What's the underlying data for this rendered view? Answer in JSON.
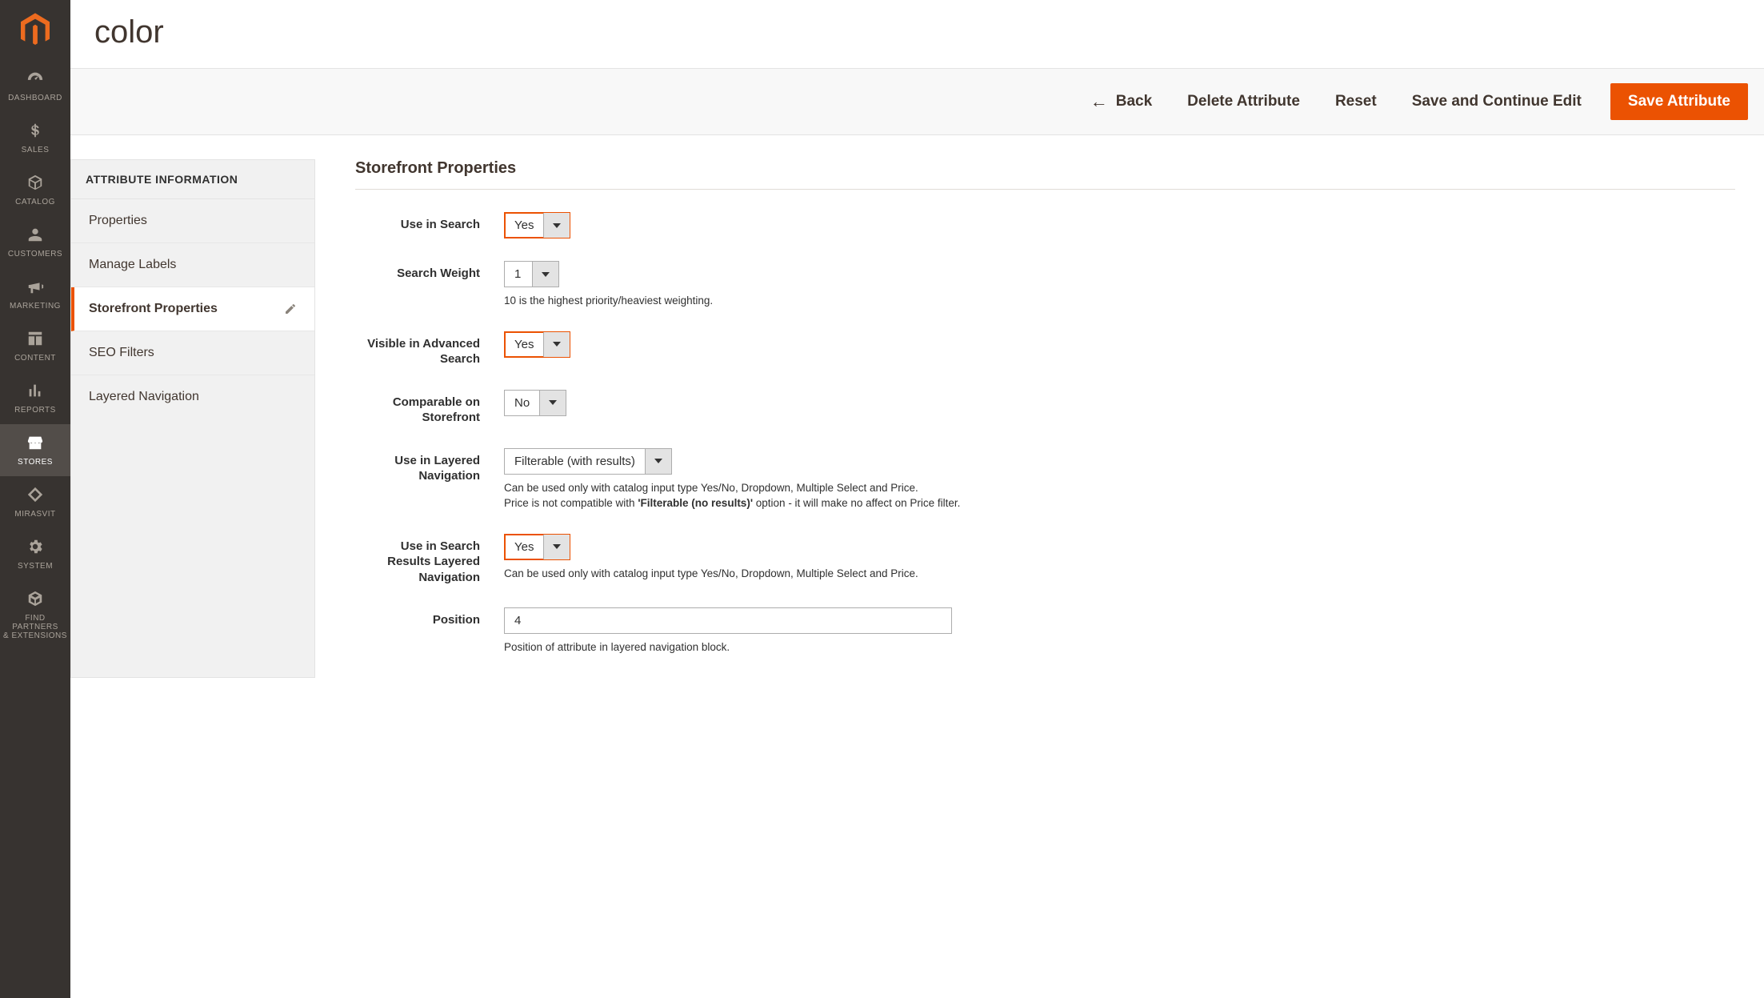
{
  "page_title": "color",
  "nav": [
    {
      "id": "dashboard",
      "label": "DASHBOARD"
    },
    {
      "id": "sales",
      "label": "SALES"
    },
    {
      "id": "catalog",
      "label": "CATALOG"
    },
    {
      "id": "customers",
      "label": "CUSTOMERS"
    },
    {
      "id": "marketing",
      "label": "MARKETING"
    },
    {
      "id": "content",
      "label": "CONTENT"
    },
    {
      "id": "reports",
      "label": "REPORTS"
    },
    {
      "id": "stores",
      "label": "STORES"
    },
    {
      "id": "mirasvit",
      "label": "MIRASVIT"
    },
    {
      "id": "system",
      "label": "SYSTEM"
    },
    {
      "id": "partners",
      "label": "FIND PARTNERS\n& EXTENSIONS"
    }
  ],
  "actions": {
    "back": "Back",
    "delete": "Delete Attribute",
    "reset": "Reset",
    "save_continue": "Save and Continue Edit",
    "save": "Save Attribute"
  },
  "sidepanel": {
    "header": "ATTRIBUTE INFORMATION",
    "items": [
      "Properties",
      "Manage Labels",
      "Storefront Properties",
      "SEO Filters",
      "Layered Navigation"
    ],
    "active_index": 2
  },
  "form": {
    "section_title": "Storefront Properties",
    "use_in_search": {
      "label": "Use in Search",
      "value": "Yes"
    },
    "search_weight": {
      "label": "Search Weight",
      "value": "1",
      "note": "10 is the highest priority/heaviest weighting."
    },
    "visible_adv_search": {
      "label": "Visible in Advanced Search",
      "value": "Yes"
    },
    "comparable": {
      "label": "Comparable on Storefront",
      "value": "No"
    },
    "layered_nav": {
      "label": "Use in Layered Navigation",
      "value": "Filterable (with results)",
      "note_a": "Can be used only with catalog input type Yes/No, Dropdown, Multiple Select and Price.",
      "note_b_pre": "Price is not compatible with ",
      "note_b_bold": "'Filterable (no results)'",
      "note_b_post": " option - it will make no affect on Price filter."
    },
    "search_results_layered": {
      "label": "Use in Search Results Layered Navigation",
      "value": "Yes",
      "note": "Can be used only with catalog input type Yes/No, Dropdown, Multiple Select and Price."
    },
    "position": {
      "label": "Position",
      "value": "4",
      "note": "Position of attribute in layered navigation block."
    }
  }
}
